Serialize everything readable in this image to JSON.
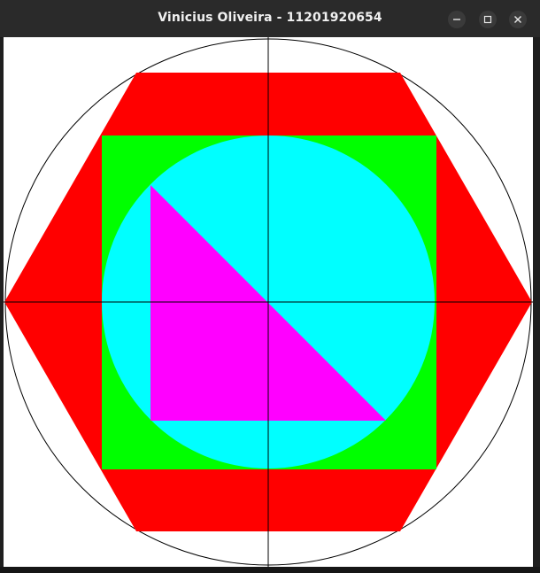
{
  "window": {
    "title": "Vinicius Oliveira - 11201920654",
    "buttons": {
      "minimize_icon": "minimize-icon",
      "maximize_icon": "maximize-icon",
      "close_icon": "close-icon"
    }
  },
  "drawing": {
    "background_color": "#ffffff",
    "shapes": [
      {
        "name": "outer-circle",
        "type": "circle-outline",
        "color": "#000000"
      },
      {
        "name": "hexagon",
        "type": "hexagon",
        "color": "#ff0000"
      },
      {
        "name": "square",
        "type": "square",
        "color": "#00ff00"
      },
      {
        "name": "inner-circle",
        "type": "circle",
        "color": "#00ffff"
      },
      {
        "name": "triangle",
        "type": "right-triangle",
        "color": "#ff00ff"
      },
      {
        "name": "axes",
        "type": "crosshair-lines",
        "color": "#000000"
      }
    ]
  }
}
